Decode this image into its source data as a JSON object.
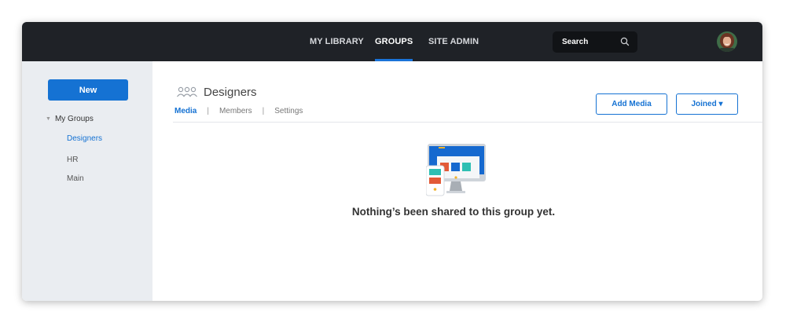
{
  "nav": {
    "items": [
      {
        "label": "MY LIBRARY",
        "active": false
      },
      {
        "label": "GROUPS",
        "active": true
      },
      {
        "label": "SITE ADMIN",
        "active": false
      }
    ],
    "search_label": "Search"
  },
  "sidebar": {
    "new_label": "New",
    "tree_title": "My Groups",
    "items": [
      {
        "label": "Designers",
        "active": true
      },
      {
        "label": "HR",
        "active": false
      },
      {
        "label": "Main",
        "active": false
      }
    ]
  },
  "group": {
    "title": "Designers",
    "tabs": [
      {
        "label": "Media",
        "active": true
      },
      {
        "label": "Members",
        "active": false
      },
      {
        "label": "Settings",
        "active": false
      }
    ],
    "add_media_label": "Add Media",
    "joined_label": "Joined ▾"
  },
  "empty_state": {
    "message": "Nothing’s been shared to this group yet."
  },
  "colors": {
    "accent": "#1572d3",
    "topbar": "#1f2227",
    "sidebar": "#eaedf1"
  }
}
